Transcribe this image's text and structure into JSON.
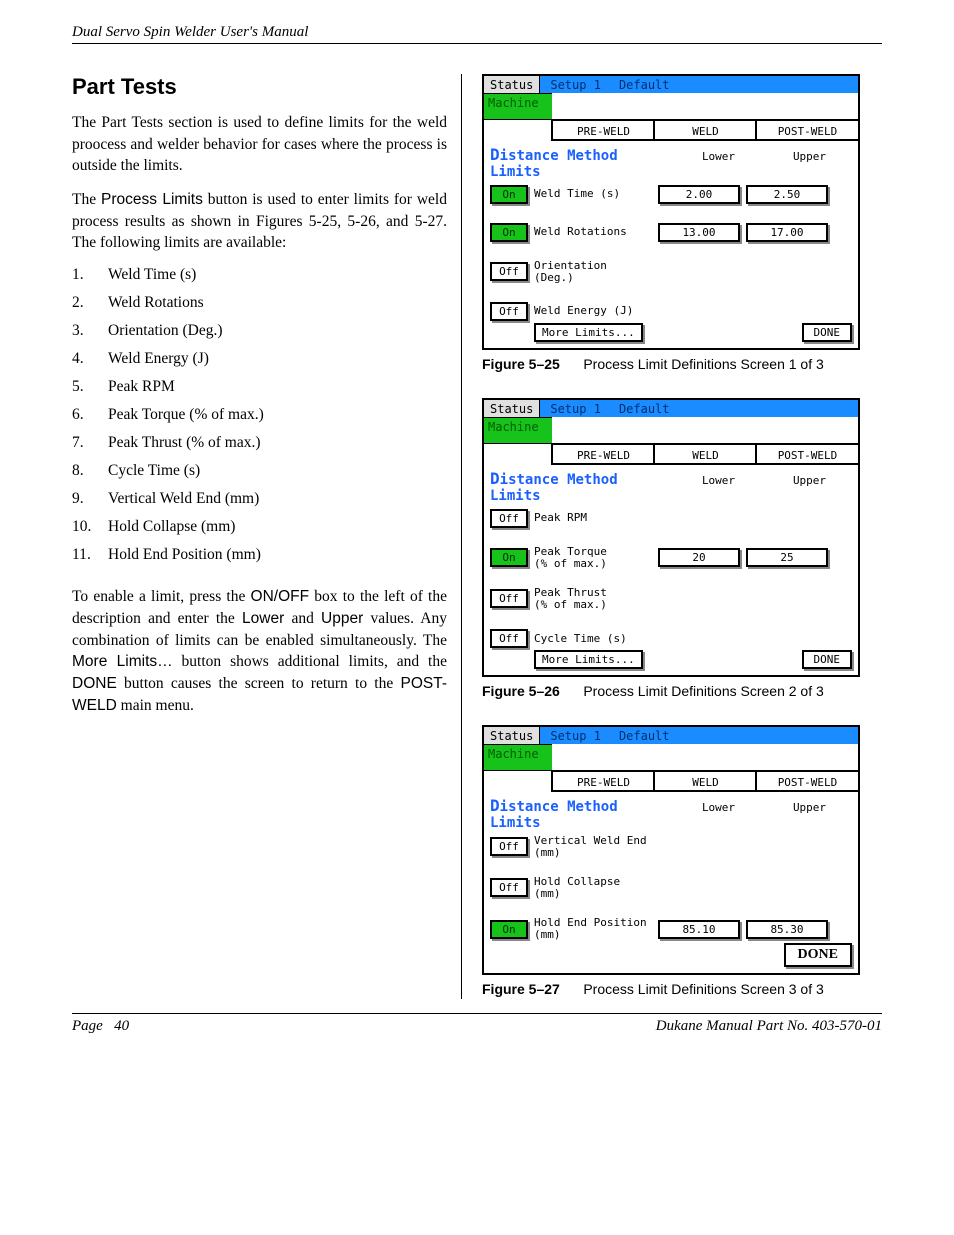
{
  "running_head": "Dual Servo Spin Welder User's Manual",
  "section_title": "Part Tests",
  "para1": "The Part Tests section is used to define limits for the weld proocess and welder behavior for cases where the process is outside the limits.",
  "para2a": "The ",
  "para2b": "Process Limits",
  "para2c": " button is used to enter limits for weld process results as shown in Figures 5-25, 5-26, and 5-27. The following limits are available:",
  "limits_list": [
    "Weld Time (s)",
    "Weld Rotations",
    "Orientation (Deg.)",
    "Weld Energy (J)",
    "Peak RPM",
    "Peak Torque (% of max.)",
    "Peak Thrust (% of max.)",
    "Cycle Time (s)",
    "Vertical Weld End (mm)",
    "Hold Collapse (mm)",
    "Hold End Position (mm)"
  ],
  "para3_parts": [
    {
      "t": "To enable a limit, press the ",
      "s": false
    },
    {
      "t": "ON/OFF",
      "s": true
    },
    {
      "t": " box to the left of the description and enter the ",
      "s": false
    },
    {
      "t": "Lower",
      "s": true
    },
    {
      "t": " and ",
      "s": false
    },
    {
      "t": "Upper",
      "s": true
    },
    {
      "t": " values. Any combination of limits can be enabled simultaneously. The ",
      "s": false
    },
    {
      "t": "More Limits…",
      "s": true
    },
    {
      "t": " button shows additional limits, and the ",
      "s": false
    },
    {
      "t": "DONE",
      "s": true
    },
    {
      "t": " button causes the screen to return to the ",
      "s": false
    },
    {
      "t": "POST-WELD",
      "s": true
    },
    {
      "t": " main menu.",
      "s": false
    }
  ],
  "hmi_common": {
    "status": "Status",
    "setup": "Setup 1",
    "default": "Default",
    "machine": "Machine",
    "tabs": [
      "PRE-WELD",
      "WELD",
      "POST-WELD"
    ],
    "title_pre": "D",
    "title_rest": "istance Method Limits",
    "lower": "Lower",
    "upper": "Upper",
    "more": "More Limits...",
    "done": "DONE"
  },
  "screen1": {
    "rows": [
      {
        "toggle": "On",
        "on": true,
        "label": "Weld Time (s)",
        "lower": "2.00",
        "upper": "2.50"
      },
      {
        "toggle": "On",
        "on": true,
        "label": "Weld Rotations",
        "lower": "13.00",
        "upper": "17.00"
      },
      {
        "toggle": "Off",
        "on": false,
        "label": "Orientation (Deg.)",
        "lower": "",
        "upper": ""
      },
      {
        "toggle": "Off",
        "on": false,
        "label": "Weld Energy (J)",
        "lower": "",
        "upper": ""
      }
    ],
    "caption_num": "Figure 5–25",
    "caption_text": "Process Limit Definitions Screen 1 of 3"
  },
  "screen2": {
    "rows": [
      {
        "toggle": "Off",
        "on": false,
        "label": "Peak RPM",
        "lower": "",
        "upper": ""
      },
      {
        "toggle": "On",
        "on": true,
        "label": "Peak Torque\n(% of max.)",
        "lower": "20",
        "upper": "25"
      },
      {
        "toggle": "Off",
        "on": false,
        "label": "Peak Thrust\n(% of max.)",
        "lower": "",
        "upper": ""
      },
      {
        "toggle": "Off",
        "on": false,
        "label": "Cycle Time (s)",
        "lower": "",
        "upper": ""
      }
    ],
    "caption_num": "Figure 5–26",
    "caption_text": "Process Limit Definitions Screen 2 of 3"
  },
  "screen3": {
    "rows": [
      {
        "toggle": "Off",
        "on": false,
        "label": "Vertical Weld End\n(mm)",
        "lower": "",
        "upper": ""
      },
      {
        "toggle": "Off",
        "on": false,
        "label": "Hold Collapse\n(mm)",
        "lower": "",
        "upper": ""
      },
      {
        "toggle": "On",
        "on": true,
        "label": "Hold End Position\n(mm)",
        "lower": "85.10",
        "upper": "85.30"
      }
    ],
    "caption_num": "Figure 5–27",
    "caption_text": "Process Limit Definitions Screen 3 of 3",
    "done_bold": true
  },
  "footer_left_a": "Page",
  "footer_left_b": "40",
  "footer_right": "Dukane Manual Part No. 403-570-01"
}
